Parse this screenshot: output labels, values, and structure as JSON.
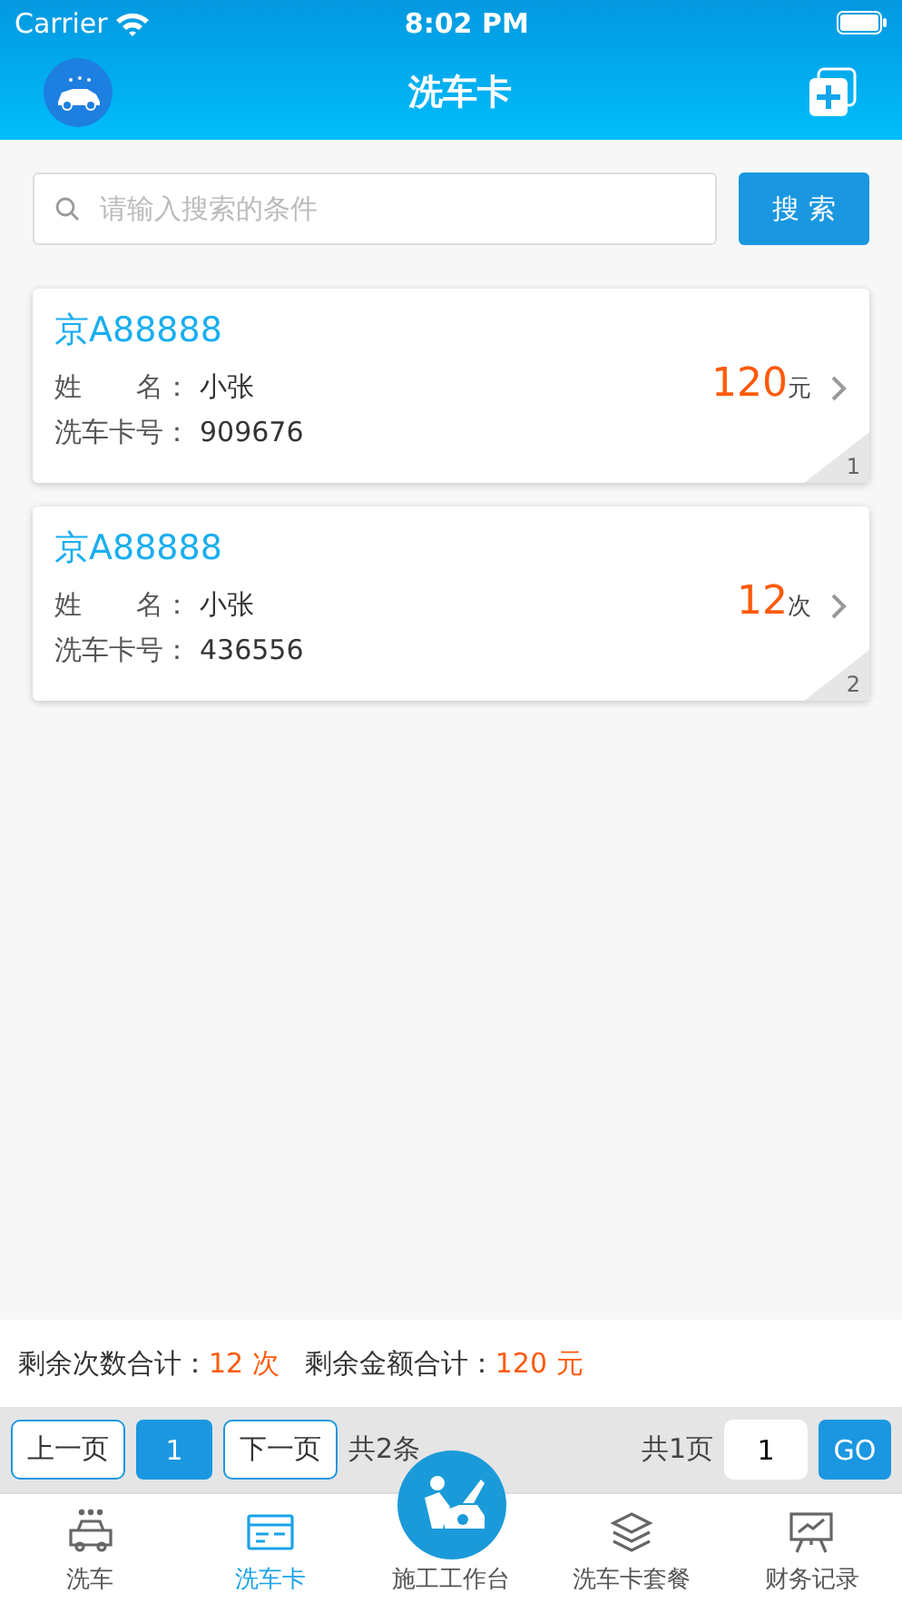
{
  "status_bar": {
    "carrier": "Carrier",
    "time": "8:02 PM"
  },
  "nav": {
    "title": "洗车卡"
  },
  "search": {
    "placeholder": "请输入搜索的条件",
    "button": "搜 索"
  },
  "cards": [
    {
      "plate": "京A88888",
      "name_label": "姓　　名：",
      "name": "小张",
      "card_label": "洗车卡号：",
      "card_no": "909676",
      "amount": "120",
      "unit": "元",
      "index": "1"
    },
    {
      "plate": "京A88888",
      "name_label": "姓　　名：",
      "name": "小张",
      "card_label": "洗车卡号：",
      "card_no": "436556",
      "amount": "12",
      "unit": "次",
      "index": "2"
    }
  ],
  "summary": [
    {
      "label": "剩余次数合计：",
      "value": "12 次"
    },
    {
      "label": "剩余金额合计：",
      "value": "120 元"
    }
  ],
  "pagination": {
    "prev": "上一页",
    "pages": [
      {
        "label": "1",
        "selected": true
      }
    ],
    "next": "下一页",
    "total_items": "共2条",
    "total_pages": "共1页",
    "page_input": "1",
    "go": "GO"
  },
  "tabs": [
    {
      "label": "洗车",
      "kind": "normal",
      "selected": false
    },
    {
      "label": "洗车卡",
      "kind": "normal",
      "selected": true
    },
    {
      "label": "施工工作台",
      "kind": "center",
      "selected": false
    },
    {
      "label": "洗车卡套餐",
      "kind": "normal",
      "selected": false
    },
    {
      "label": "财务记录",
      "kind": "normal",
      "selected": false
    }
  ]
}
